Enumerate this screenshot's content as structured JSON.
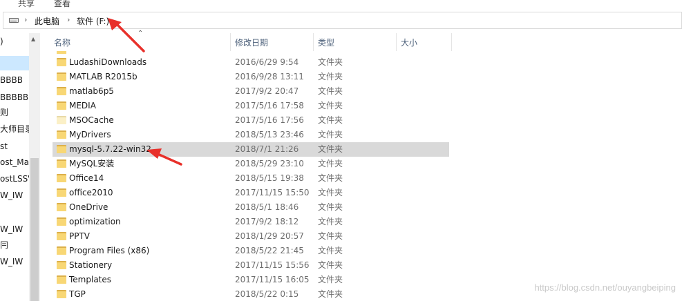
{
  "ribbon": {
    "tab_share": "共享",
    "tab_view": "查看"
  },
  "address": {
    "drive_icon": "drive-icon",
    "crumbs": [
      "此电脑",
      "软件 (F:)"
    ]
  },
  "nav": {
    "items": [
      "",
      ")",
      "",
      "BBBB",
      "BBBBB",
      "则",
      "大师目录",
      "st",
      "ost_Mat",
      "ostLSSV",
      "W_IW",
      "",
      "W_IW",
      "冃",
      "W_IW"
    ]
  },
  "columns": {
    "name": "名称",
    "date": "修改日期",
    "type": "类型",
    "size": "大小"
  },
  "files": [
    {
      "name": "LudashiDownloads",
      "date": "2016/6/29 9:54",
      "type": "文件夹"
    },
    {
      "name": "MATLAB R2015b",
      "date": "2016/9/28 13:11",
      "type": "文件夹"
    },
    {
      "name": "matlab6p5",
      "date": "2017/9/2 20:47",
      "type": "文件夹"
    },
    {
      "name": "MEDIA",
      "date": "2017/5/16 17:58",
      "type": "文件夹"
    },
    {
      "name": "MSOCache",
      "date": "2017/5/16 17:56",
      "type": "文件夹"
    },
    {
      "name": "MyDrivers",
      "date": "2018/5/13 23:46",
      "type": "文件夹"
    },
    {
      "name": "mysql-5.7.22-win32",
      "date": "2018/7/1 21:26",
      "type": "文件夹"
    },
    {
      "name": "MySQL安装",
      "date": "2018/5/29 23:10",
      "type": "文件夹"
    },
    {
      "name": "Office14",
      "date": "2018/5/15 19:38",
      "type": "文件夹"
    },
    {
      "name": "office2010",
      "date": "2017/11/15 15:50",
      "type": "文件夹"
    },
    {
      "name": "OneDrive",
      "date": "2018/5/1 18:46",
      "type": "文件夹"
    },
    {
      "name": "optimization",
      "date": "2017/9/2 18:12",
      "type": "文件夹"
    },
    {
      "name": "PPTV",
      "date": "2018/1/29 20:57",
      "type": "文件夹"
    },
    {
      "name": "Program Files (x86)",
      "date": "2018/5/22 21:45",
      "type": "文件夹"
    },
    {
      "name": "Stationery",
      "date": "2017/11/15 15:56",
      "type": "文件夹"
    },
    {
      "name": "Templates",
      "date": "2017/11/15 16:05",
      "type": "文件夹"
    },
    {
      "name": "TGP",
      "date": "2018/5/22 0:15",
      "type": "文件夹"
    }
  ],
  "selected_index": 6,
  "pale_index": 4,
  "colors": {
    "arrow": "#e8302a",
    "selected_row": "#d9d9d9",
    "nav_selected": "#cce8ff"
  },
  "watermark": "https://blog.csdn.net/ouyangbeiping"
}
